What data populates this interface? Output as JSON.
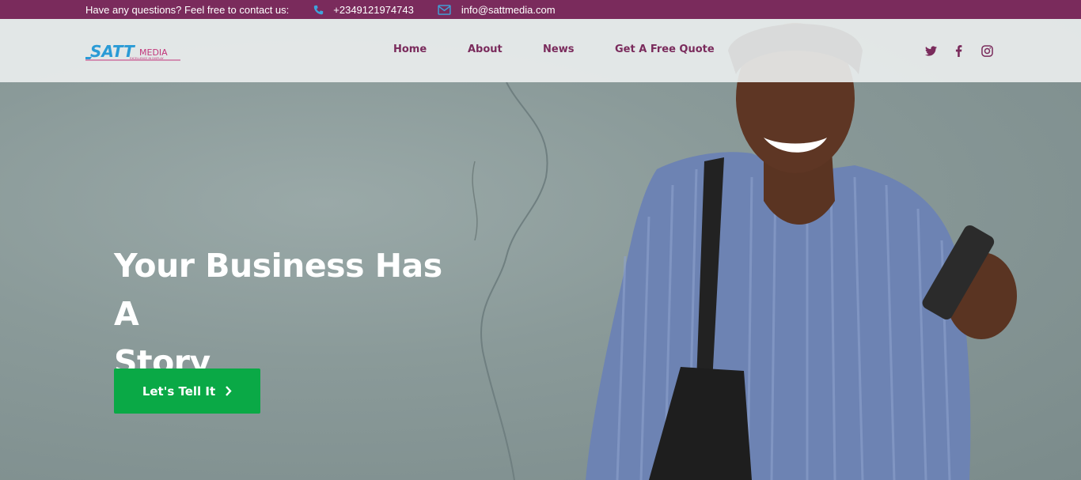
{
  "topbar": {
    "question": "Have any questions? Feel free to contact us:",
    "phone": "+2349121974743",
    "email": "info@sattmedia.com",
    "phone_icon": "phone-icon",
    "email_icon": "envelope-icon"
  },
  "brand": {
    "logo_main": "SATT",
    "logo_sub": "MEDIA",
    "logo_tagline": "EXCELLENCE IN DISPLAY"
  },
  "nav": {
    "items": [
      {
        "label": "Home"
      },
      {
        "label": "About"
      },
      {
        "label": "News"
      },
      {
        "label": "Get A Free Quote"
      }
    ]
  },
  "social": [
    "twitter-icon",
    "facebook-icon",
    "instagram-icon"
  ],
  "hero": {
    "headline_line1": "Your Business Has A",
    "headline_line2": "Story",
    "cta_label": "Let's Tell It"
  },
  "colors": {
    "brand": "#7a2b5c",
    "cta": "#0aa946",
    "logo_blue": "#2a9bd6",
    "logo_pink": "#c2367b"
  }
}
